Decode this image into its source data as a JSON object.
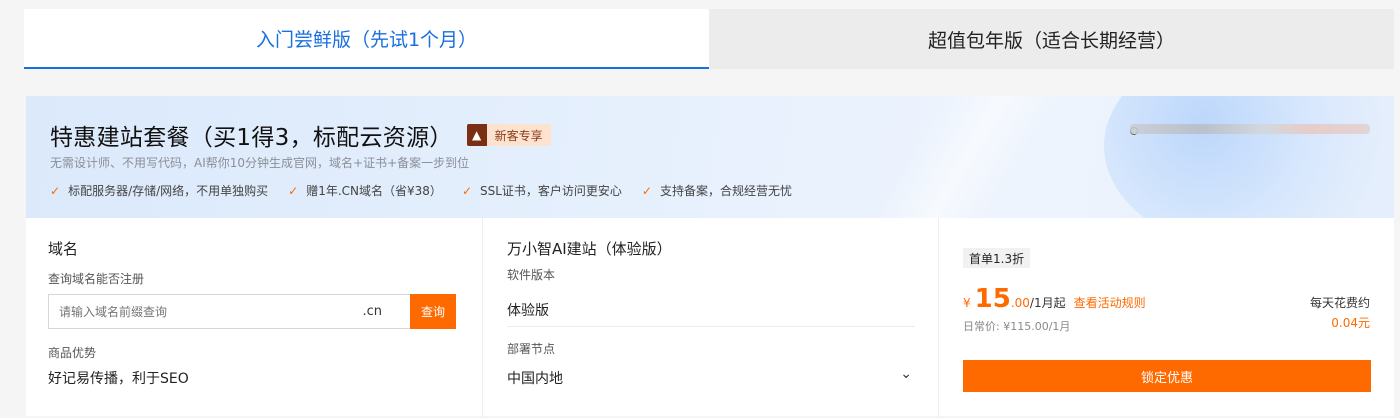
{
  "tabs": [
    {
      "label": "入门尝鲜版（先试1个月）",
      "active": true
    },
    {
      "label": "超值包年版（适合长期经营）",
      "active": false
    }
  ],
  "banner": {
    "title": "特惠建站套餐（买1得3，标配云资源）",
    "badge_icon": "flame-icon",
    "badge_label": "新客专享",
    "subtitle": "无需设计师、不用写代码，AI帮你10分钟生成官网，域名+证书+备案一步到位",
    "features": [
      "标配服务器/存储/网络，不用单独购买",
      "赠1年.CN域名（省¥38）",
      "SSL证书，客户访问更安心",
      "支持备案，合规经营无忧"
    ]
  },
  "domain": {
    "section_title": "域名",
    "query_label": "查询域名能否注册",
    "input_placeholder": "请输入域名前缀查询",
    "suffix": ".cn",
    "query_button": "查询",
    "advantage_label": "商品优势",
    "advantage_value": "好记易传播，利于SEO"
  },
  "product": {
    "section_title": "万小智AI建站（体验版）",
    "version_label": "软件版本",
    "version_value": "体验版",
    "node_label": "部署节点",
    "node_value": "中国内地"
  },
  "pricing": {
    "discount_tag": "首单1.3折",
    "currency": "¥",
    "price_int": "15",
    "price_dec": ".00",
    "price_unit": "/1月起",
    "rule_link": "查看活动规则",
    "daily_price": "日常价: ¥115.00/1月",
    "per_day_label": "每天花费约",
    "per_day_value": "0.04元",
    "lock_button": "锁定优惠"
  },
  "colors": {
    "accent_blue": "#1a6fe0",
    "accent_orange": "#ff6a00"
  }
}
